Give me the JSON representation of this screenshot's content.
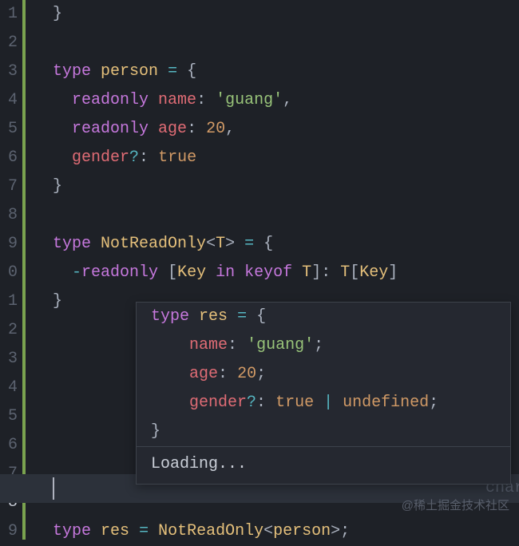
{
  "gutter": [
    "1",
    "2",
    "3",
    "4",
    "5",
    "6",
    "7",
    "8",
    "9",
    "0",
    "1",
    "2",
    "3",
    "4",
    "5",
    "6",
    "7",
    "8",
    "9"
  ],
  "active_line_index": 17,
  "code": {
    "l1_brace": "}",
    "l3_type": "type",
    "l3_name": "person",
    "l3_eq": "=",
    "l3_open": "{",
    "l4_ro": "readonly",
    "l4_prop": "name",
    "l4_colon": ":",
    "l4_val": "'guang'",
    "l4_comma": ",",
    "l5_ro": "readonly",
    "l5_prop": "age",
    "l5_colon": ":",
    "l5_val": "20",
    "l5_comma": ",",
    "l6_prop": "gender",
    "l6_q": "?",
    "l6_colon": ":",
    "l6_val": "true",
    "l7_close": "}",
    "l9_type": "type",
    "l9_name": "NotReadOnly",
    "l9_lt": "<",
    "l9_t": "T",
    "l9_gt": ">",
    "l9_eq": "=",
    "l9_open": "{",
    "l10_minus": "-",
    "l10_ro": "readonly",
    "l10_lb": "[",
    "l10_key1": "Key",
    "l10_in": "in",
    "l10_keyof": "keyof",
    "l10_t": "T",
    "l10_rb": "]",
    "l10_colon": ":",
    "l10_t2": "T",
    "l10_lb2": "[",
    "l10_key2": "Key",
    "l10_rb2": "]",
    "l11_close": "}",
    "l19_type": "type",
    "l19_name": "res",
    "l19_eq": "=",
    "l19_alias": "NotReadOnly",
    "l19_lt": "<",
    "l19_arg": "person",
    "l19_gt": ">",
    "l19_semi": ";"
  },
  "hover": {
    "h1_type": "type",
    "h1_name": "res",
    "h1_eq": "=",
    "h1_open": "{",
    "h2_prop": "name",
    "h2_colon": ":",
    "h2_val": "'guang'",
    "h2_semi": ";",
    "h3_prop": "age",
    "h3_colon": ":",
    "h3_val": "20",
    "h3_semi": ";",
    "h4_prop": "gender",
    "h4_q": "?",
    "h4_colon": ":",
    "h4_val": "true",
    "h4_pipe": "|",
    "h4_undef": "undefined",
    "h4_semi": ";",
    "h5_close": "}",
    "loading": "Loading..."
  },
  "ghost": "char",
  "watermark": "@稀土掘金技术社区"
}
